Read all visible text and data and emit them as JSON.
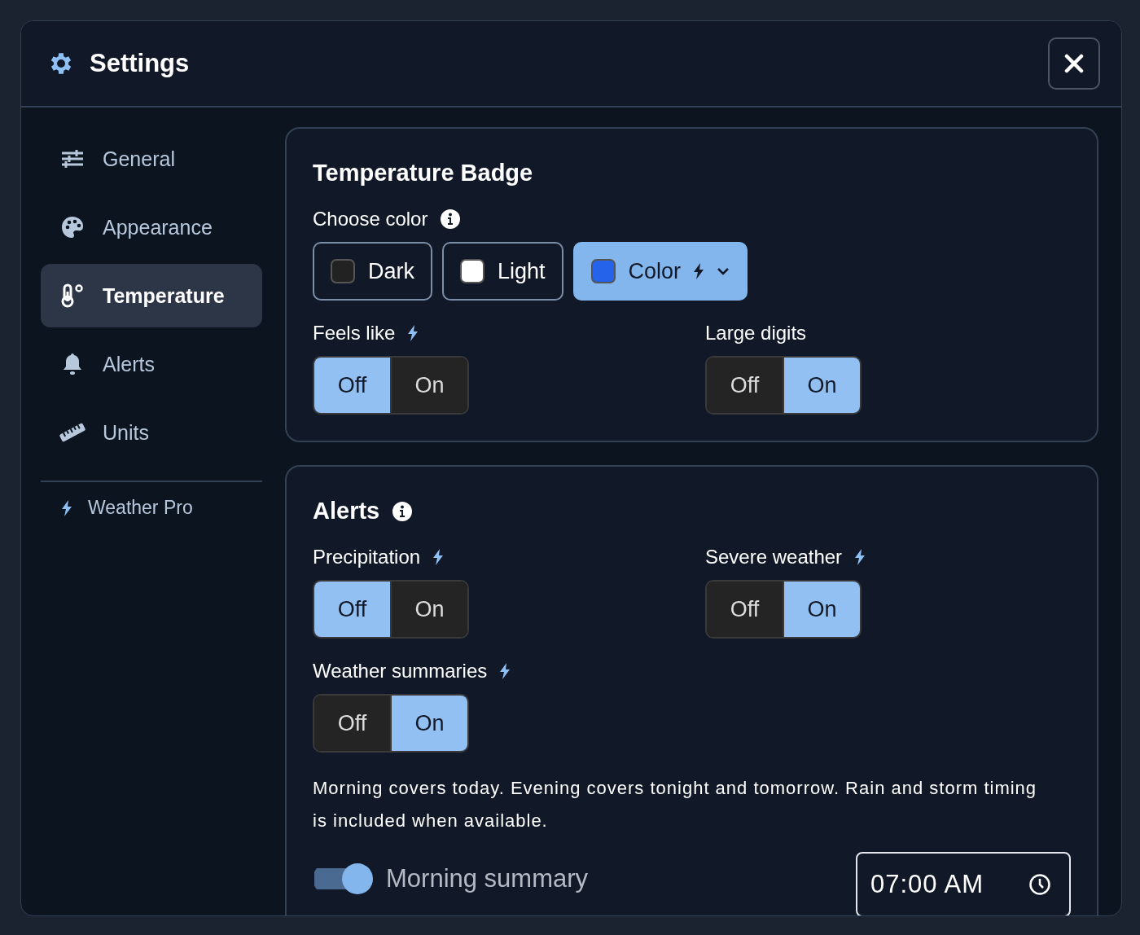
{
  "window": {
    "title": "Settings"
  },
  "sidebar": {
    "items": [
      {
        "label": "General",
        "selected": false
      },
      {
        "label": "Appearance",
        "selected": false
      },
      {
        "label": "Temperature",
        "selected": true
      },
      {
        "label": "Alerts",
        "selected": false
      },
      {
        "label": "Units",
        "selected": false
      }
    ],
    "footer_link": {
      "label": "Weather Pro"
    }
  },
  "sections": [
    {
      "title": "Temperature Badge",
      "info": false,
      "color_picker": {
        "label": "Choose color",
        "info": true,
        "options": [
          {
            "label": "Dark",
            "color": "#222222",
            "selected": false,
            "kind": "swatch"
          },
          {
            "label": "Light",
            "color": "#ffffff",
            "selected": false,
            "kind": "swatch"
          },
          {
            "label": "Color",
            "color": "#2563eb",
            "selected": true,
            "kind": "dropdown"
          }
        ]
      },
      "toggles": [
        {
          "label": "Feels like",
          "pro": true,
          "options": [
            {
              "label": "Off",
              "selected": true
            },
            {
              "label": "On",
              "selected": false
            }
          ]
        },
        {
          "label": "Large digits",
          "pro": false,
          "options": [
            {
              "label": "Off",
              "selected": false
            },
            {
              "label": "On",
              "selected": true
            }
          ]
        }
      ]
    },
    {
      "title": "Alerts",
      "info": true,
      "toggles": [
        {
          "label": "Precipitation",
          "pro": true,
          "options": [
            {
              "label": "Off",
              "selected": true
            },
            {
              "label": "On",
              "selected": false
            }
          ]
        },
        {
          "label": "Severe weather",
          "pro": true,
          "options": [
            {
              "label": "Off",
              "selected": false
            },
            {
              "label": "On",
              "selected": true
            }
          ]
        },
        {
          "label": "Weather summaries",
          "pro": true,
          "options": [
            {
              "label": "Off",
              "selected": false
            },
            {
              "label": "On",
              "selected": true
            }
          ]
        }
      ],
      "description": "Morning covers today. Evening covers tonight and tomorrow. Rain and storm timing is included when available.",
      "schedule": {
        "label": "Morning summary",
        "on": true,
        "time": "07:00 AM"
      }
    }
  ]
}
